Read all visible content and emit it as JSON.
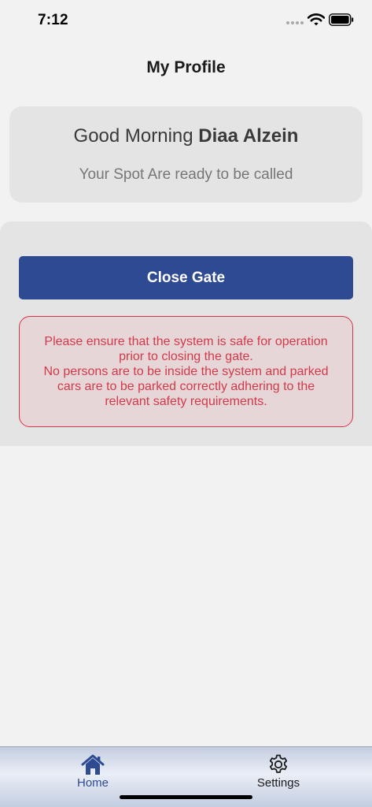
{
  "status_bar": {
    "time": "7:12",
    "icons": [
      "signal-dots-icon",
      "wifi-icon",
      "battery-icon"
    ]
  },
  "header": {
    "title": "My Profile"
  },
  "greeting": {
    "prefix": "Good Morning",
    "name": "Diaa Alzein",
    "subtitle": "Your Spot Are ready to be called"
  },
  "gate": {
    "button_label": "Close Gate",
    "warning_lines": [
      "Please ensure that the system is safe for operation",
      "prior to closing the gate.",
      "No persons are to be inside the system and parked",
      "cars are to be parked correctly adhering to the",
      "relevant safety requirements."
    ]
  },
  "tab_bar": {
    "items": [
      {
        "label": "Home",
        "icon": "home-icon",
        "active": true
      },
      {
        "label": "Settings",
        "icon": "gear-icon",
        "active": false
      }
    ]
  },
  "colors": {
    "primary": "#2d4a93",
    "warning_text": "#d23a4a",
    "warning_border": "#d9334a",
    "warning_bg": "#e6d6d7",
    "card_bg": "#e4e4e4",
    "screen_bg": "#f2f2f2"
  }
}
